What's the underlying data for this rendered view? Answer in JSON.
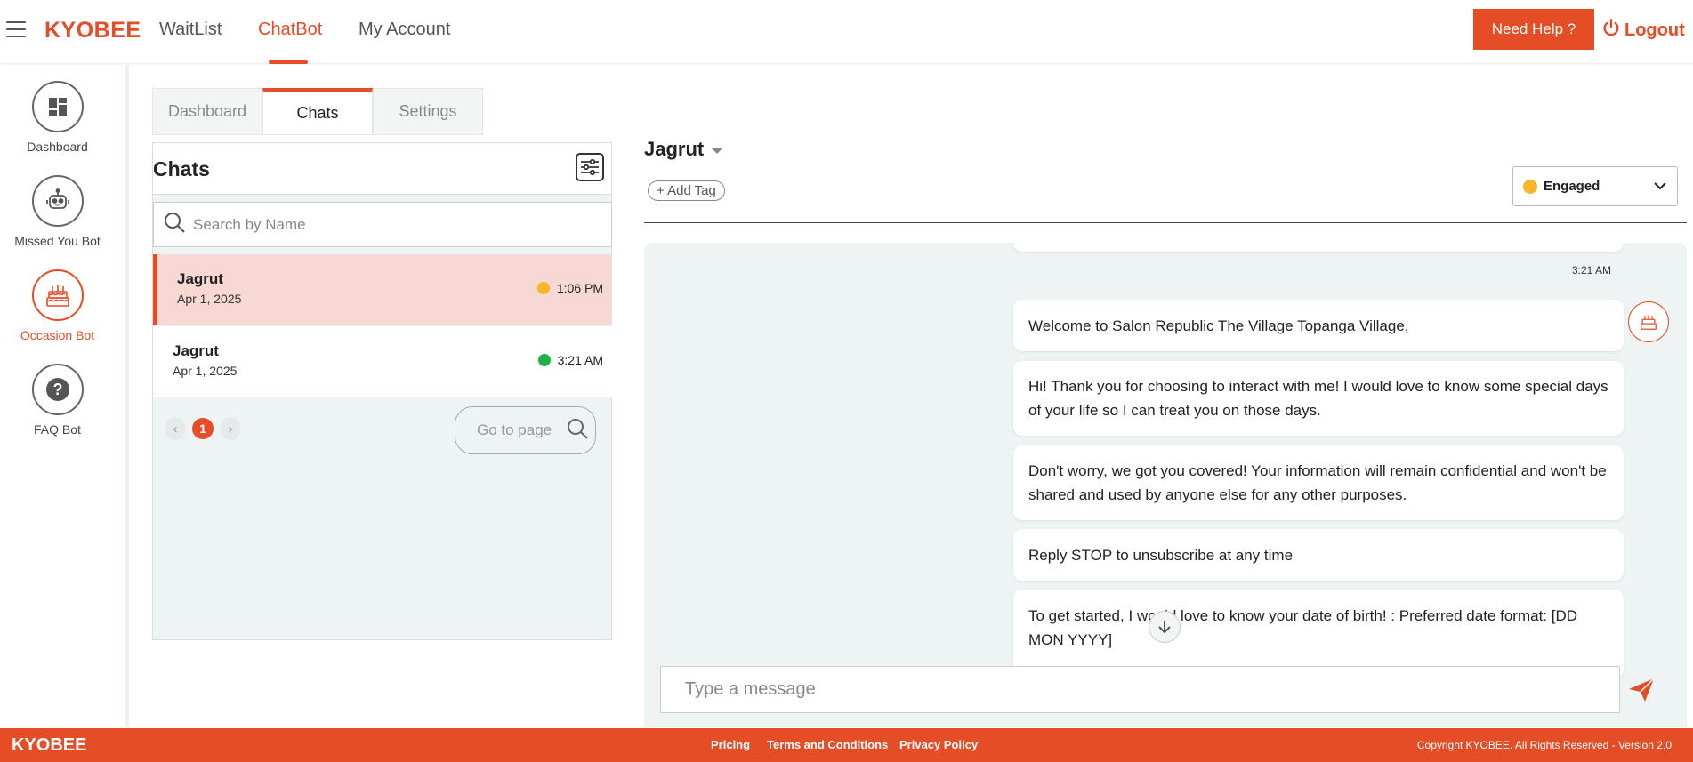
{
  "header": {
    "brand": "KYOBEE",
    "nav": [
      {
        "label": "WaitList",
        "active": false
      },
      {
        "label": "ChatBot",
        "active": true
      },
      {
        "label": "My Account",
        "active": false
      }
    ],
    "help_label": "Need Help ?",
    "logout_label": "Logout",
    "accent_color": "#e44d26"
  },
  "sidebar": {
    "items": [
      {
        "label": "Dashboard",
        "icon": "dashboard-grid-icon",
        "active": false
      },
      {
        "label": "Missed You Bot",
        "icon": "robot-icon",
        "active": false
      },
      {
        "label": "Occasion Bot",
        "icon": "birthday-cake-icon",
        "active": true
      },
      {
        "label": "FAQ Bot",
        "icon": "question-mark-icon",
        "active": false
      }
    ]
  },
  "tabs": [
    {
      "label": "Dashboard",
      "active": false
    },
    {
      "label": "Chats",
      "active": true
    },
    {
      "label": "Settings",
      "active": false
    }
  ],
  "chats": {
    "title": "Chats",
    "search_placeholder": "Search by Name",
    "list": [
      {
        "name": "Jagrut",
        "date": "Apr 1, 2025",
        "time": "1:06 PM",
        "status_color": "#f6b62b",
        "selected": true
      },
      {
        "name": "Jagrut",
        "date": "Apr 1, 2025",
        "time": "3:21 AM",
        "status_color": "#1fb141",
        "selected": false
      }
    ],
    "pagination": {
      "prev": "‹",
      "next": "›",
      "current_page": "1",
      "goto_placeholder": "Go to page"
    }
  },
  "conversation": {
    "contact_name": "Jagrut",
    "add_tag_label": "+ Add Tag",
    "status": {
      "label": "Engaged",
      "color": "#f6b62b"
    },
    "timestamp": "3:21 AM",
    "messages": [
      "Welcome to Salon Republic The Village Topanga Village,",
      "Hi! Thank you for choosing to interact with me! I would love to know some special days of your life so I can treat you on those days.",
      "Don't worry, we got you covered! Your information will remain confidential and won't be shared and used by anyone else for any other purposes.",
      "Reply STOP to unsubscribe at any time",
      "To get started, I would love to know your date of birth! : Preferred date format: [DD MON YYYY]"
    ],
    "composer_placeholder": "Type a message"
  },
  "footer": {
    "brand": "KYOBEE",
    "links": [
      "Pricing",
      "Terms and Conditions",
      "Privacy Policy"
    ],
    "copyright": "Copyright KYOBEE. All Rights Reserved - Version 2.0"
  }
}
